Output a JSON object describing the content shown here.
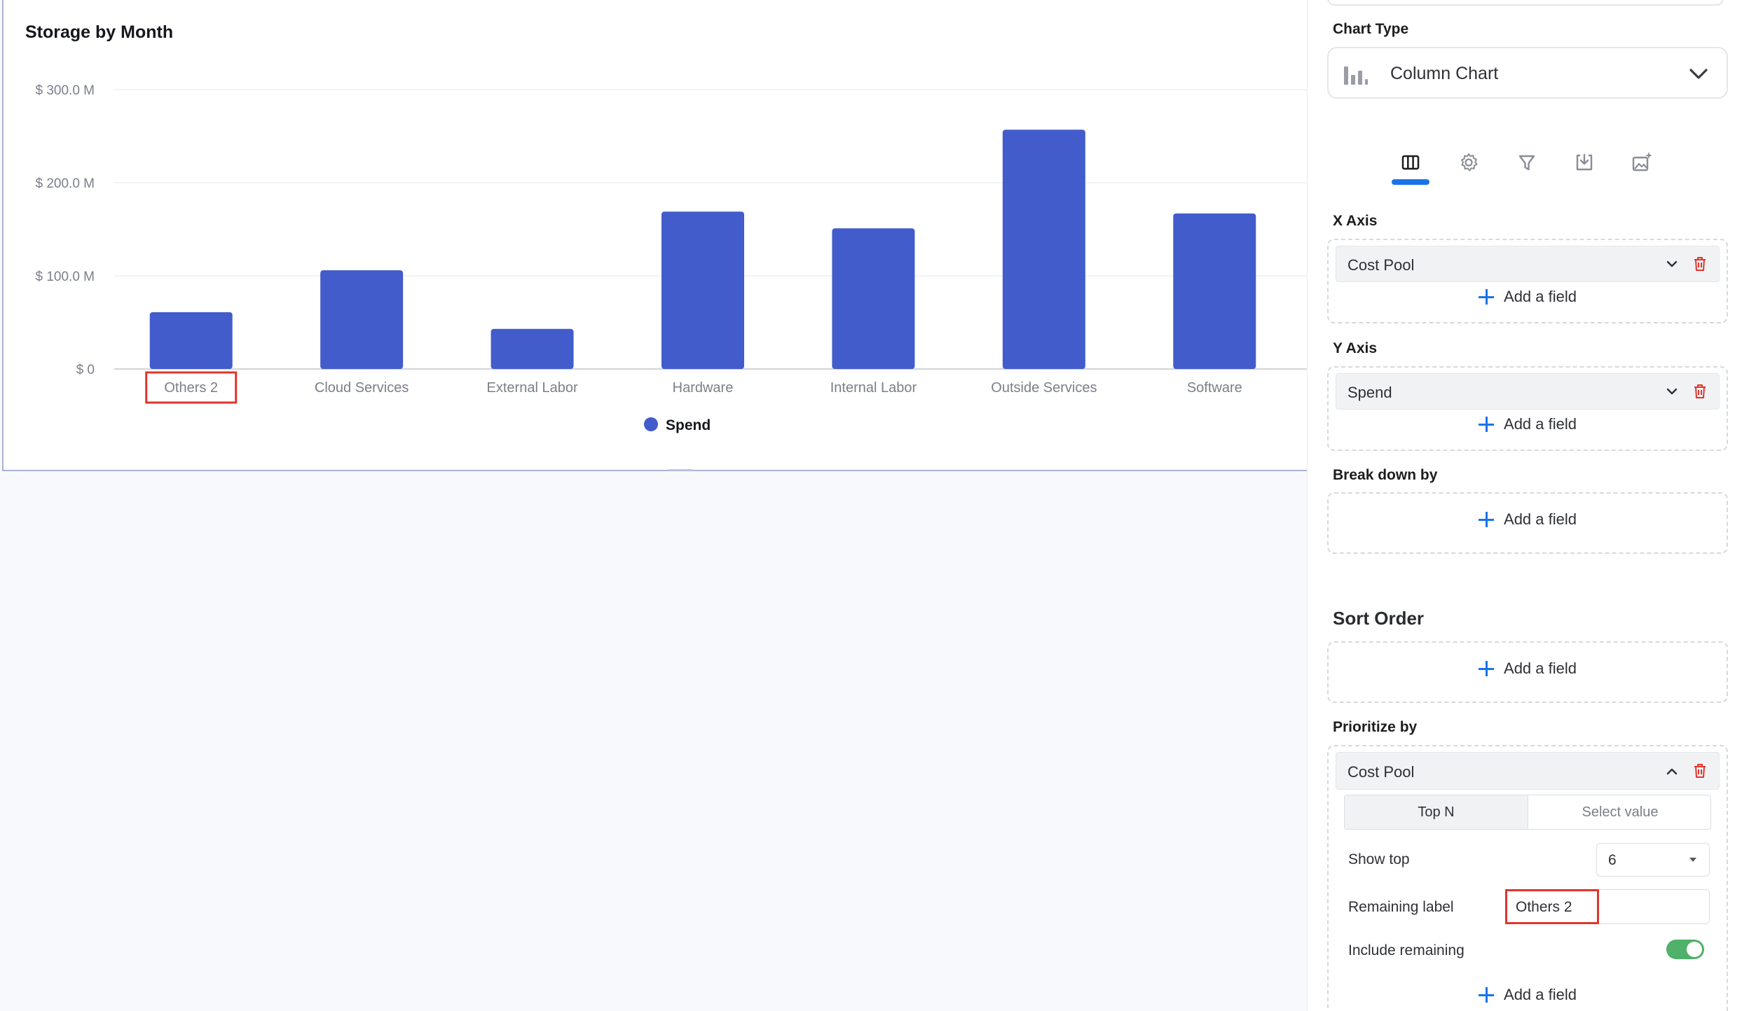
{
  "chart": {
    "title": "Storage by Month",
    "highlight_category": "Others 2"
  },
  "chart_data": {
    "type": "bar",
    "title": "Storage by Month",
    "categories": [
      "Others 2",
      "Cloud Services",
      "External Labor",
      "Hardware",
      "Internal Labor",
      "Outside Services",
      "Software"
    ],
    "series": [
      {
        "name": "Spend",
        "values": [
          61,
          106,
          43,
          169,
          151,
          257,
          167
        ],
        "color": "#425ccb"
      }
    ],
    "y_ticks": [
      "$ 0",
      "$ 100.0 M",
      "$ 200.0 M",
      "$ 300.0 M"
    ],
    "y_tick_values": [
      0,
      100,
      200,
      300
    ],
    "ylim": [
      0,
      300
    ],
    "y_unit": "$ M",
    "xlabel": "",
    "ylabel": "",
    "legend_position": "bottom-center",
    "grid": true
  },
  "panel": {
    "chart_type_label": "Chart Type",
    "chart_type_value": "Column Chart",
    "tabs": [
      {
        "name": "columns-icon",
        "active": true
      },
      {
        "name": "gear-icon",
        "active": false
      },
      {
        "name": "filter-icon",
        "active": false
      },
      {
        "name": "download-icon",
        "active": false
      },
      {
        "name": "ai-image-icon",
        "active": false
      }
    ],
    "x_axis": {
      "label": "X Axis",
      "field": "Cost Pool",
      "add": "Add a field"
    },
    "y_axis": {
      "label": "Y Axis",
      "field": "Spend",
      "add": "Add a field"
    },
    "break_down": {
      "label": "Break down by",
      "add": "Add a field"
    },
    "sort_order": {
      "label": "Sort Order",
      "add": "Add a field"
    },
    "prioritize": {
      "label": "Prioritize by",
      "field": "Cost Pool",
      "segments": [
        "Top N",
        "Select value"
      ],
      "show_top_label": "Show top",
      "show_top_value": "6",
      "remaining_label": "Remaining label",
      "remaining_value": "Others 2",
      "include_remaining_label": "Include remaining",
      "include_remaining": true,
      "add": "Add a field"
    }
  },
  "colors": {
    "accent": "#1a73e8",
    "bar": "#425ccb",
    "toggle_on": "#4fb16a",
    "highlight": "#e0352b",
    "delete": "#e0352b"
  }
}
